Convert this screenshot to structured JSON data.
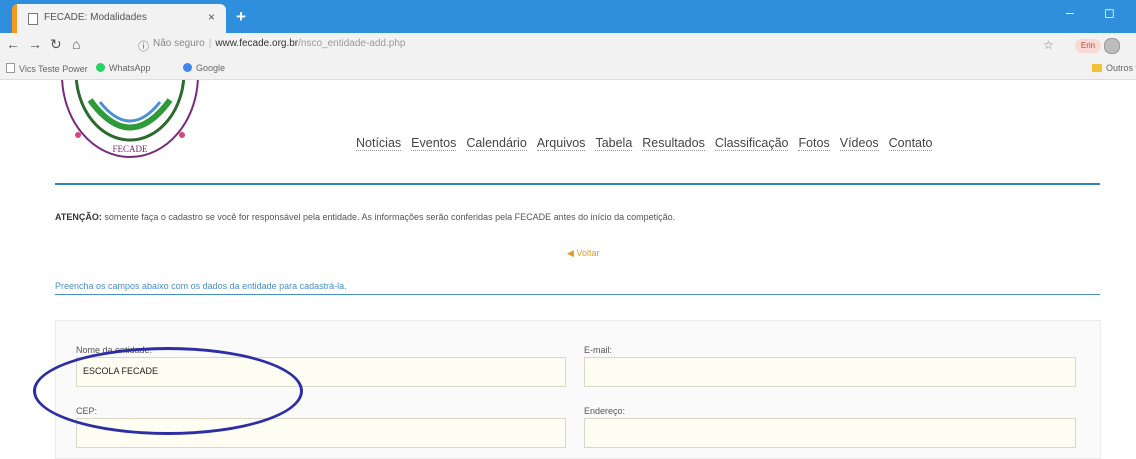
{
  "browser": {
    "tab_title": "FECADE: Modalidades",
    "tab_close": "×",
    "new_tab": "+",
    "win_min": "–",
    "win_max": "◻",
    "omnibox": {
      "security": "Não seguro",
      "separator": "|",
      "domain": "www.fecade.org.br",
      "path": "/nsco_entidade-add.php"
    },
    "profile_label": "Erin",
    "bookmarks": [
      {
        "label": "Vics Teste Power",
        "icon_color": "#cccccc"
      },
      {
        "label": "WhatsApp",
        "icon_color": "#25d366"
      },
      {
        "label": "Google",
        "icon_color": "#4285f4"
      }
    ],
    "other_bookmarks": "Outros favoritos"
  },
  "site": {
    "logo_text": "FECADE",
    "nav": [
      "Notícias",
      "Eventos",
      "Calendário",
      "Arquivos",
      "Tabela",
      "Resultados",
      "Classificação",
      "Fotos",
      "Vídeos",
      "Contato"
    ]
  },
  "notice": {
    "label": "ATENÇÃO:",
    "text": "somente faça o cadastro se você for responsável pela entidade. As informações serão conferidas pela FECADE antes do início da competição."
  },
  "back_link": "Voltar",
  "instructions": "Preencha os campos abaixo com os dados da entidade para cadastrá-la.",
  "form": {
    "entity_name_label": "Nome da entidade:",
    "entity_name_value": "ESCOLA FECADE",
    "email_label": "E-mail:",
    "email_value": "",
    "cep_label": "CEP:",
    "cep_value": "",
    "address_label": "Endereço:",
    "address_value": ""
  },
  "colors": {
    "chrome_blue": "#2f8fdc",
    "site_accent": "#2e86c1",
    "highlight_circle": "#2d2ea5",
    "back_link": "#e39b1f"
  }
}
